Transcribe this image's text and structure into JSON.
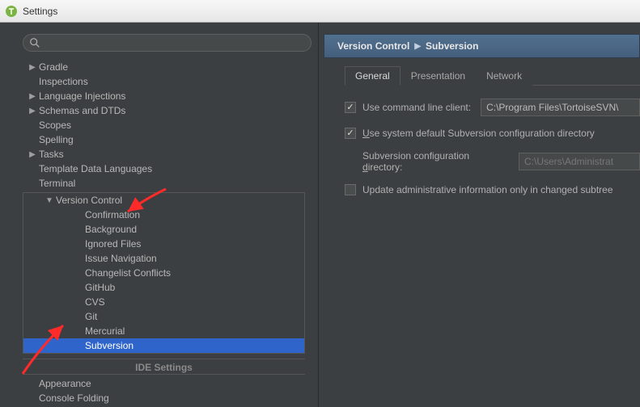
{
  "window": {
    "title": "Settings"
  },
  "sidebar": {
    "search_placeholder": "",
    "items": [
      {
        "label": "Gradle",
        "level": 1,
        "arrow": "▶"
      },
      {
        "label": "Inspections",
        "level": 1
      },
      {
        "label": "Language Injections",
        "level": 1,
        "arrow": "▶"
      },
      {
        "label": "Schemas and DTDs",
        "level": 1,
        "arrow": "▶"
      },
      {
        "label": "Scopes",
        "level": 1
      },
      {
        "label": "Spelling",
        "level": 1
      },
      {
        "label": "Tasks",
        "level": 1,
        "arrow": "▶"
      },
      {
        "label": "Template Data Languages",
        "level": 1
      },
      {
        "label": "Terminal",
        "level": 1
      }
    ],
    "vc_label": "Version Control",
    "vc_arrow": "▼",
    "vc_children": [
      "Confirmation",
      "Background",
      "Ignored Files",
      "Issue Navigation",
      "Changelist Conflicts",
      "GitHub",
      "CVS",
      "Git",
      "Mercurial",
      "Subversion"
    ],
    "ide_header": "IDE Settings",
    "ide_items": [
      "Appearance",
      "Console Folding"
    ]
  },
  "breadcrumb": {
    "a": "Version Control",
    "b": "Subversion"
  },
  "tabs": {
    "general": "General",
    "presentation": "Presentation",
    "network": "Network"
  },
  "form": {
    "use_cli_label": "Use command line client:",
    "use_cli_value": "C:\\Program Files\\TortoiseSVN\\",
    "use_default_prefix": "U",
    "use_default_rest": "se system default Subversion configuration directory",
    "dir_prefix": "Subversion configuration ",
    "dir_mnemonic": "d",
    "dir_rest": "irectory:",
    "dir_value": "C:\\Users\\Administrat",
    "update_label": "Update administrative information only in changed subtree"
  }
}
